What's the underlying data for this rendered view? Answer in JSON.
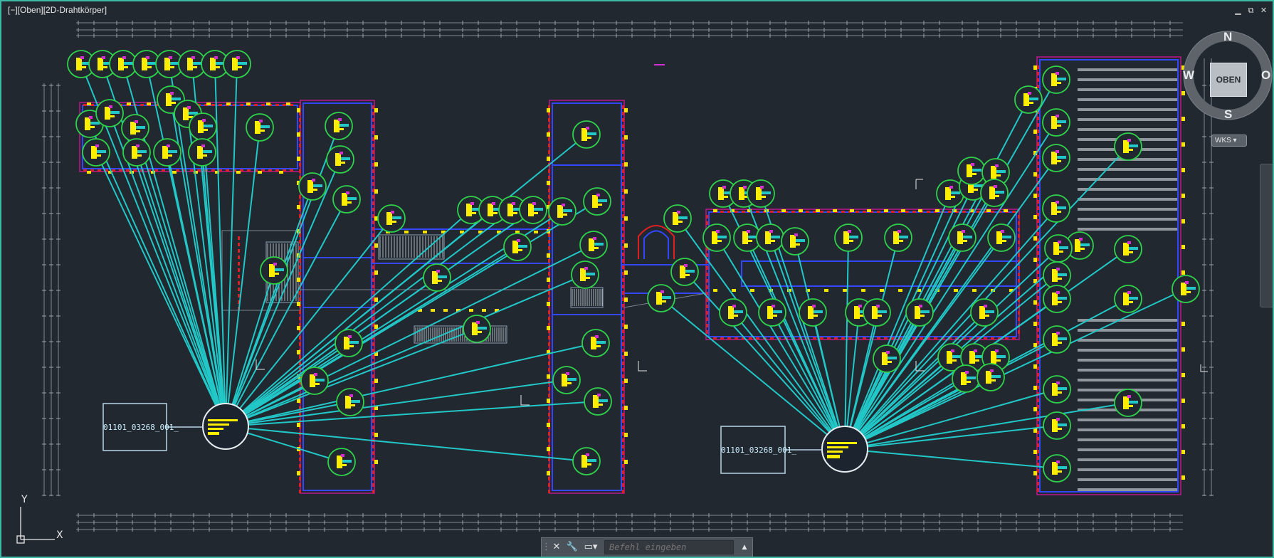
{
  "viewport": {
    "label": "[−][Oben][2D-Drahtkörper]",
    "controls": {
      "minimize": "▁",
      "restore": "⧉",
      "close": "✕"
    }
  },
  "viewcube": {
    "face": "OBEN",
    "north": "N",
    "south": "S",
    "west": "W",
    "east": "O",
    "wcs": "WKS ▾"
  },
  "command_line": {
    "close_icon": "close-icon",
    "settings_icon": "wrench-icon",
    "prompt_icon": "prompt-icon",
    "placeholder": "Befehl eingeben",
    "history_toggle": "▲"
  },
  "ucs": {
    "x": "X",
    "y": "Y"
  },
  "blocks": {
    "left_label": "01101_03268_001_",
    "right_label": "01101_03268_001_"
  },
  "colors": {
    "background": "#212830",
    "viewport_border": "#3fb9a3",
    "leader_lines": "#22c7c7",
    "symbol_circles": "#2fd24a",
    "walls": "#3347ff",
    "accent_magenta": "#d32fd3",
    "symbols_yellow": "#ffee00"
  }
}
